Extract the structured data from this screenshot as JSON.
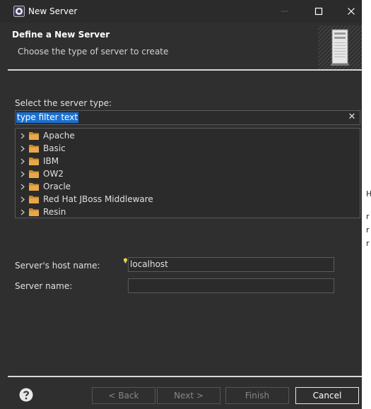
{
  "window": {
    "title": "New Server",
    "controls": {
      "minimize": "minimize-icon",
      "maximize": "maximize-icon",
      "close": "close-icon"
    }
  },
  "banner": {
    "title": "Define a New Server",
    "subtitle": "Choose the type of server to create"
  },
  "server_type": {
    "label": "Select the server type:",
    "filter_value": "type filter text",
    "tree_items": [
      {
        "label": "Apache"
      },
      {
        "label": "Basic"
      },
      {
        "label": "IBM"
      },
      {
        "label": "OW2"
      },
      {
        "label": "Oracle"
      },
      {
        "label": "Red Hat JBoss Middleware"
      },
      {
        "label": "Resin"
      }
    ]
  },
  "host": {
    "label": "Server's host name:",
    "value": "localhost"
  },
  "server_name": {
    "label": "Server name:",
    "value": ""
  },
  "buttons": {
    "back": "< Back",
    "next": "Next >",
    "finish": "Finish",
    "cancel": "Cancel"
  },
  "side_fragments": [
    "H",
    "r",
    "r",
    "r"
  ],
  "colors": {
    "background": "#2f2f2f",
    "selection": "#1a6fd1",
    "folder": "#e8a84a"
  }
}
